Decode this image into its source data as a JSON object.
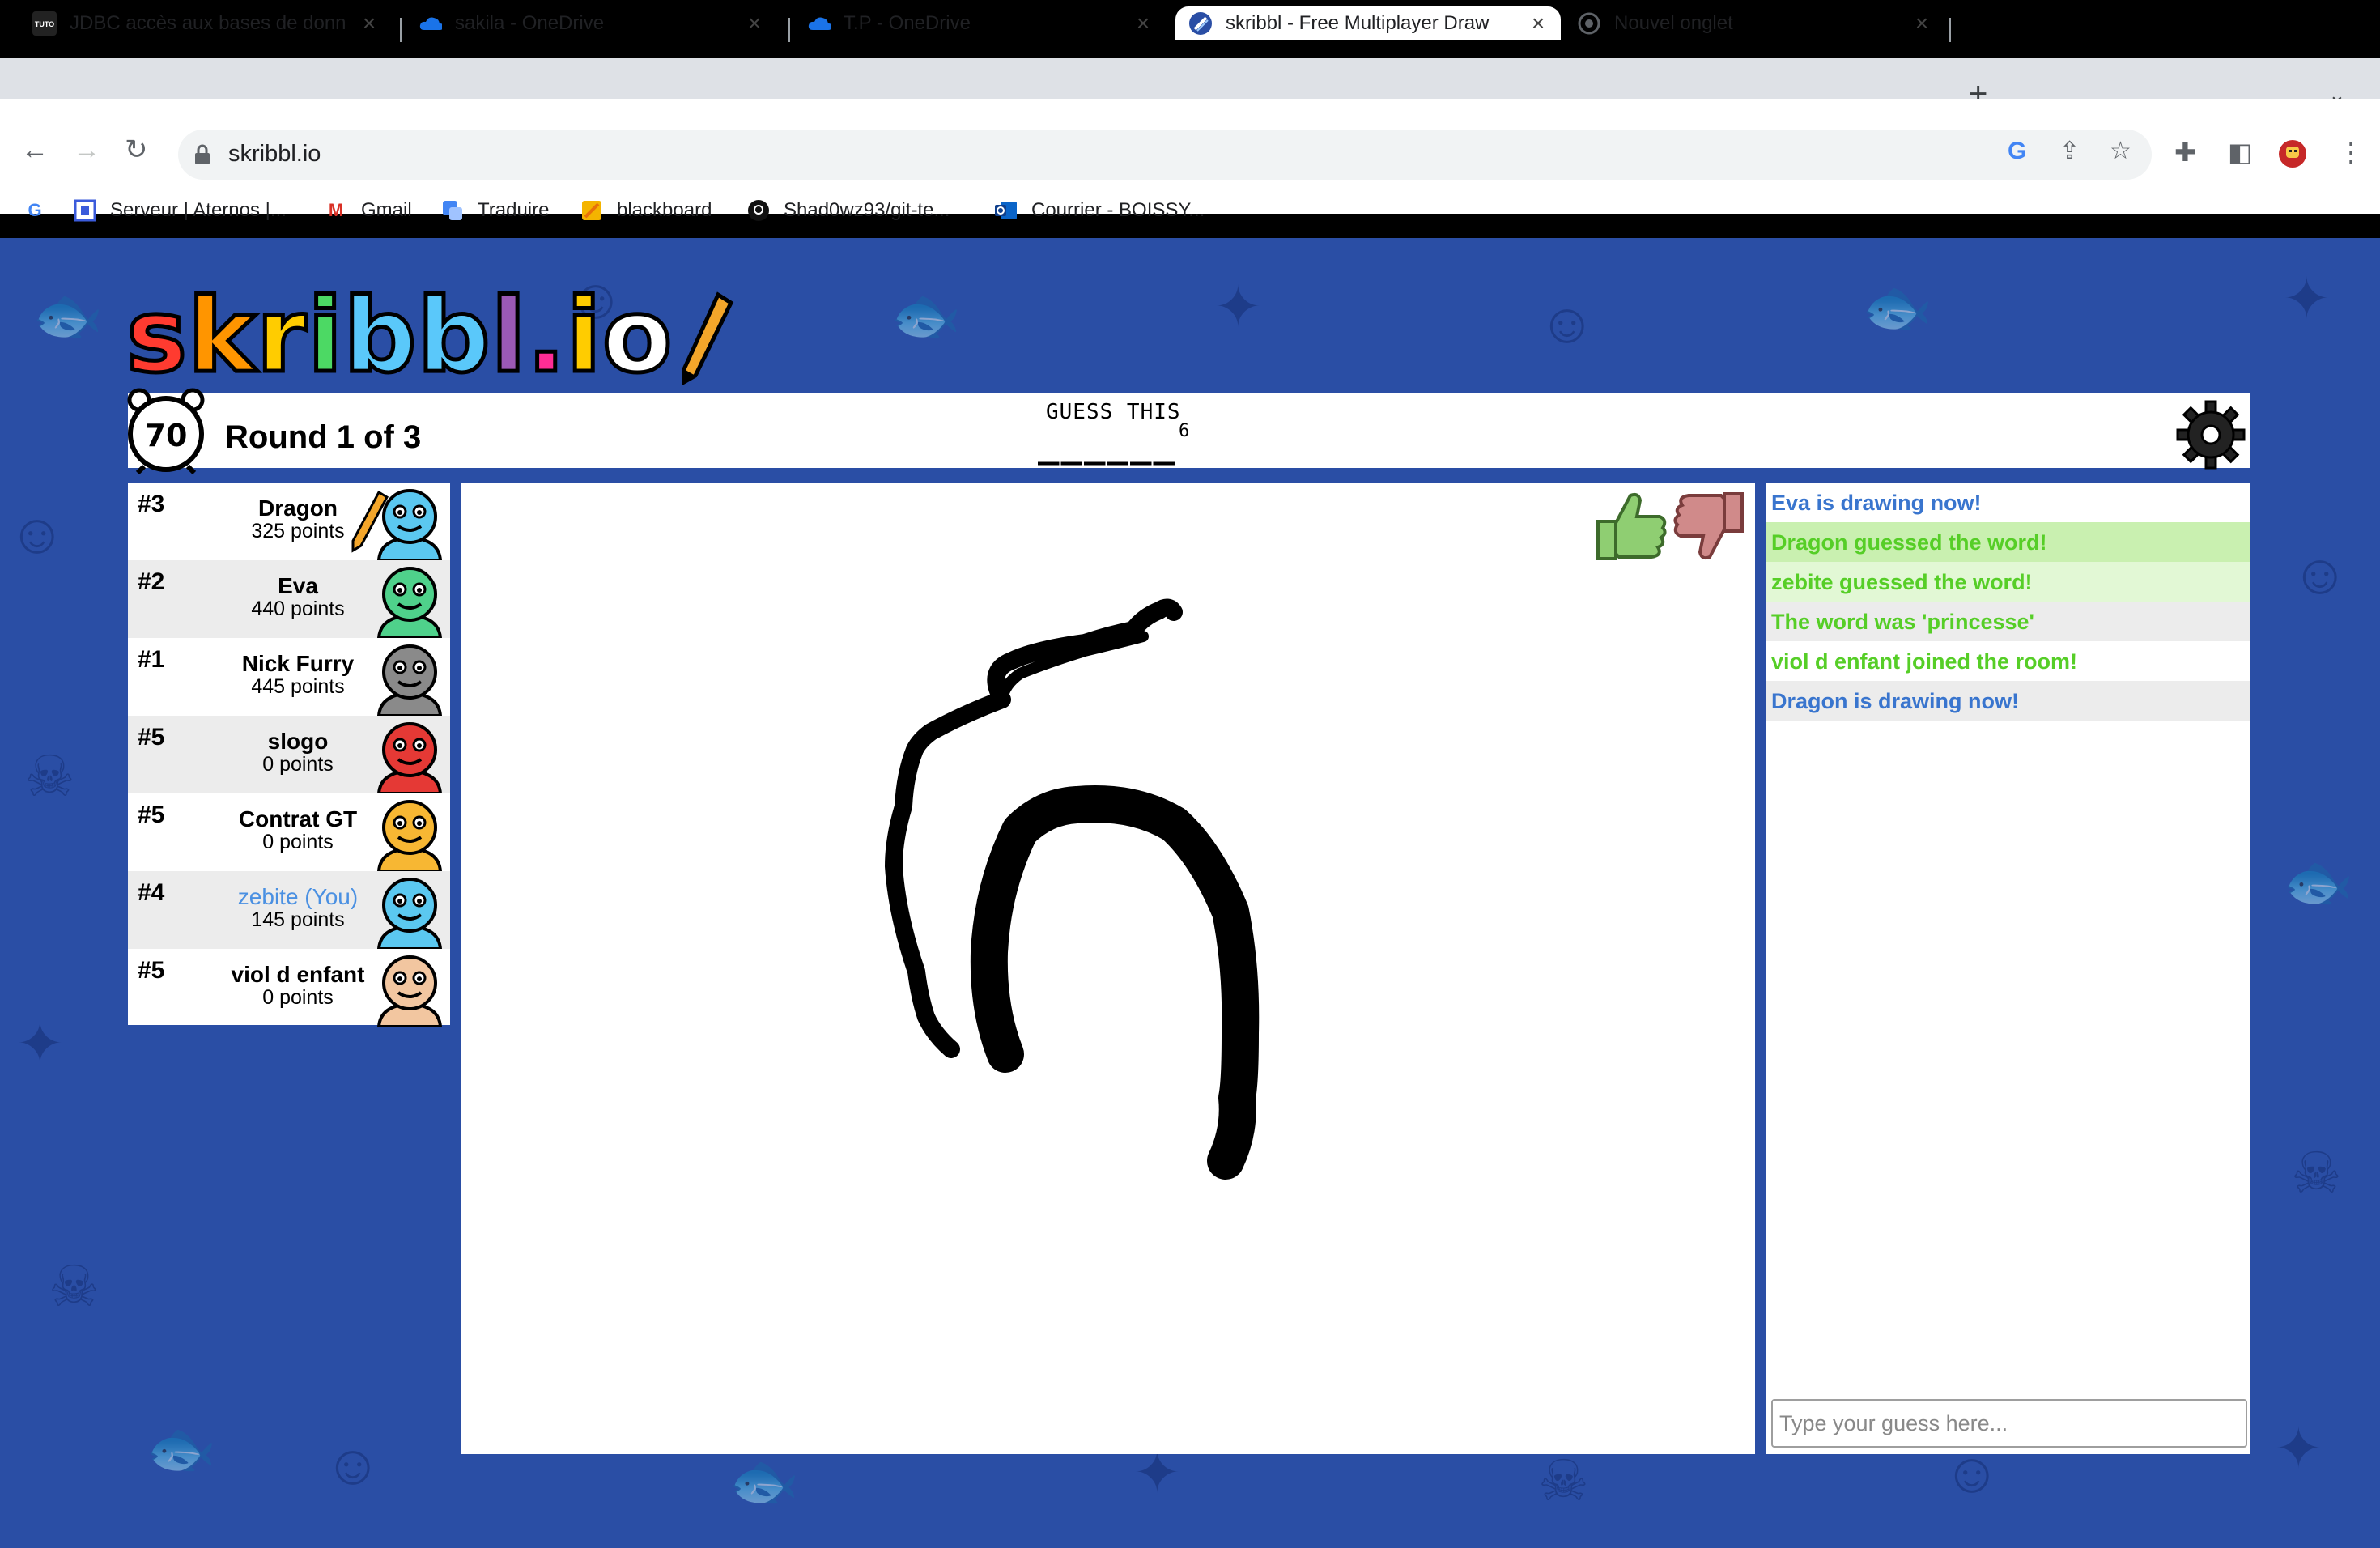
{
  "browser": {
    "tabs": [
      {
        "title": "JDBC accès aux bases de donn",
        "icon": "tuto-favicon",
        "active": false
      },
      {
        "title": "sakila - OneDrive",
        "icon": "onedrive-cloud-icon",
        "active": false
      },
      {
        "title": "T.P - OneDrive",
        "icon": "onedrive-cloud-icon",
        "active": false
      },
      {
        "title": "skribbl - Free Multiplayer Draw",
        "icon": "skribbl-favicon",
        "active": true
      },
      {
        "title": "Nouvel onglet",
        "icon": "chrome-icon",
        "active": false
      }
    ],
    "url": "skribbl.io",
    "bookmarks": [
      {
        "label": "",
        "icon": "google-icon"
      },
      {
        "label": "Serveur | Aternos |...",
        "icon": "aternos-icon"
      },
      {
        "label": "Gmail",
        "icon": "gmail-icon"
      },
      {
        "label": "Traduire",
        "icon": "translate-icon"
      },
      {
        "label": "blackboard",
        "icon": "blackboard-icon"
      },
      {
        "label": "Shad0wz93/git-te...",
        "icon": "github-icon"
      },
      {
        "label": "Courrier - BOISSY...",
        "icon": "outlook-icon"
      }
    ]
  },
  "game": {
    "logo_text": "skribbl.io",
    "timer": "70",
    "round": "Round 1 of 3",
    "guess_label": "GUESS THIS",
    "word_blanks": "______",
    "word_length": "6",
    "players": [
      {
        "rank": "#3",
        "name": "Dragon",
        "points": "325 points",
        "you": false,
        "drawing": true,
        "avatar_color": "#5bc8f0"
      },
      {
        "rank": "#2",
        "name": "Eva",
        "points": "440 points",
        "you": false,
        "drawing": false,
        "avatar_color": "#4fd18b"
      },
      {
        "rank": "#1",
        "name": "Nick Furry",
        "points": "445 points",
        "you": false,
        "drawing": false,
        "avatar_color": "#8a8a8a"
      },
      {
        "rank": "#5",
        "name": "slogo",
        "points": "0 points",
        "you": false,
        "drawing": false,
        "avatar_color": "#e53935"
      },
      {
        "rank": "#5",
        "name": "Contrat GT",
        "points": "0 points",
        "you": false,
        "drawing": false,
        "avatar_color": "#f7b733"
      },
      {
        "rank": "#4",
        "name": "zebite (You)",
        "points": "145 points",
        "you": true,
        "drawing": false,
        "avatar_color": "#5bc8f0"
      },
      {
        "rank": "#5",
        "name": "viol d enfant",
        "points": "0 points",
        "you": false,
        "drawing": false,
        "avatar_color": "#f2c6a0"
      }
    ],
    "chat": [
      {
        "text": "Eva is drawing now!",
        "color": "#3975ce",
        "bg": "#ffffff"
      },
      {
        "text": "Dragon guessed the word!",
        "color": "#56ce27",
        "bg": "#c9f0b0"
      },
      {
        "text": "zebite guessed the word!",
        "color": "#56ce27",
        "bg": "#e2f8d5"
      },
      {
        "text": "The word was 'princesse'",
        "color": "#56ce27",
        "bg": "#ececec"
      },
      {
        "text": "viol d enfant joined the room!",
        "color": "#56ce27",
        "bg": "#ffffff"
      },
      {
        "text": "Dragon is drawing now!",
        "color": "#3975ce",
        "bg": "#ececec"
      }
    ],
    "chat_placeholder": "Type your guess here...",
    "colors": {
      "background": "#2a4ea5",
      "guess_green": "#56ce27",
      "system_blue": "#3975ce",
      "you_blue": "#4a90e2"
    }
  }
}
